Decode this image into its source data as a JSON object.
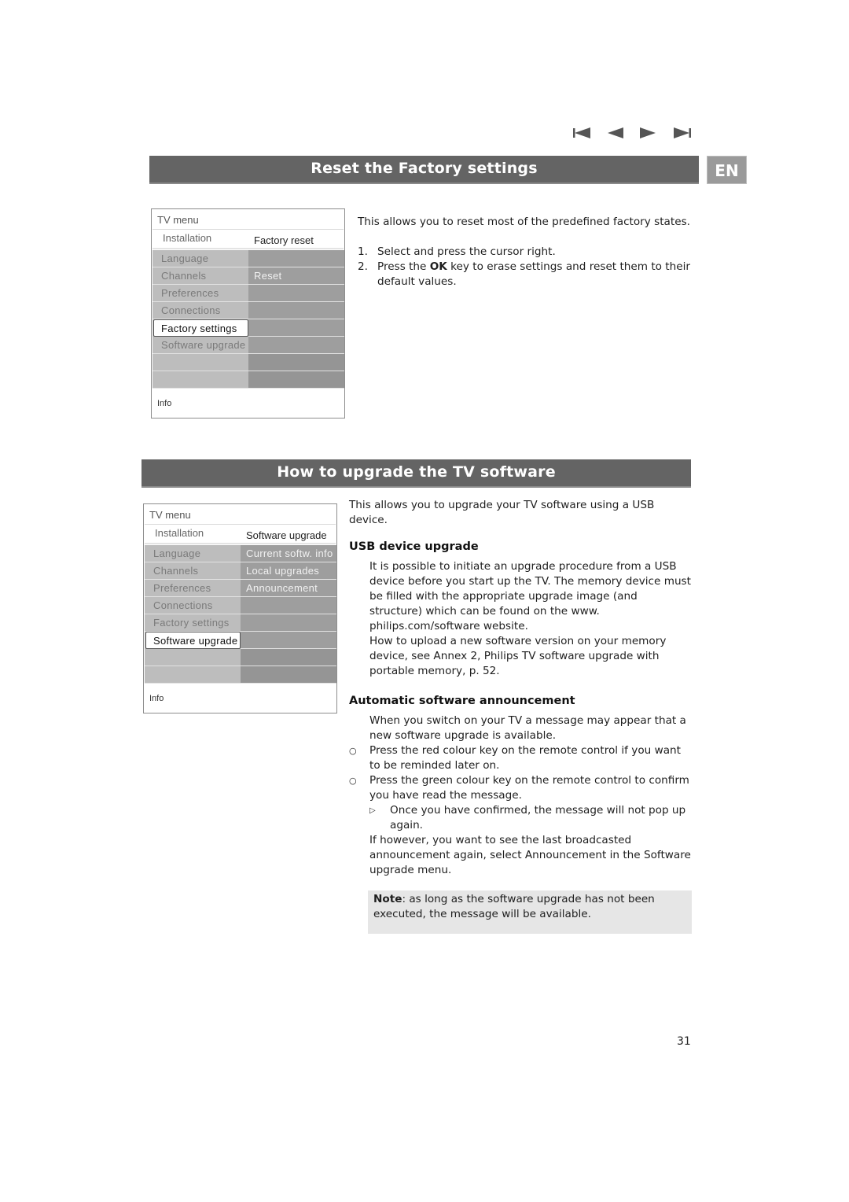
{
  "nav_icons": [
    "first-page-icon",
    "previous-page-icon",
    "next-page-icon",
    "last-page-icon"
  ],
  "language_tab": "EN",
  "section1": {
    "title": "Reset the Factory settings",
    "menu": {
      "title": "TV menu",
      "crumb": "Installation",
      "submenu_title": "Factory reset",
      "left_items": [
        "Language",
        "Channels",
        "Preferences",
        "Connections",
        "Factory settings",
        "Software upgrade",
        "",
        ""
      ],
      "selected_item": "Factory settings",
      "right_items": [
        "",
        "Reset",
        "",
        "",
        "",
        "",
        "",
        ""
      ],
      "info": "Info"
    },
    "intro": "This allows you to reset most of the predefined factory states.",
    "steps": [
      {
        "num": "1.",
        "text": "Select and press the cursor right."
      },
      {
        "num": "2.",
        "pre": "Press the ",
        "bold": "OK",
        "post": " key to erase settings and reset them to their default values."
      }
    ]
  },
  "section2": {
    "title": "How to upgrade the TV software",
    "menu": {
      "title": "TV menu",
      "crumb": "Installation",
      "submenu_title": "Software upgrade",
      "left_items": [
        "Language",
        "Channels",
        "Preferences",
        "Connections",
        "Factory settings",
        "Software upgrade",
        "",
        ""
      ],
      "selected_item": "Software upgrade",
      "right_items": [
        "Current softw. info",
        "Local upgrades",
        "Announcement",
        "",
        "",
        "",
        "",
        ""
      ],
      "info": "Info"
    },
    "intro": "This allows you to upgrade your TV software using a USB device.",
    "usb": {
      "heading": "USB device upgrade",
      "para1": "It is possible to initiate an upgrade procedure from a USB device before you start up the TV. The memory device must be filled with the appropriate upgrade image (and structure) which can be found on the www. philips.com/software website.",
      "para2": "How to upload a new software version on your memory device, see Annex 2, Philips TV software upgrade with portable memory, p. 52."
    },
    "auto": {
      "heading": "Automatic software announcement",
      "para1": "When you switch on your TV a message may appear that a new software upgrade is available.",
      "bullets": [
        "Press the red colour key on the remote control if you want to be reminded later on.",
        "Press the green colour key on the remote control to confirm you have read the message."
      ],
      "sub_bullet": "Once you have confirmed, the message will not pop up again.",
      "para2": "If however, you want to see the last broadcasted announcement again, select Announcement in the Software upgrade menu."
    },
    "note": {
      "label": "Note",
      "text": ": as long as the software upgrade has not been executed, the message will be available."
    }
  },
  "page_number": "31"
}
